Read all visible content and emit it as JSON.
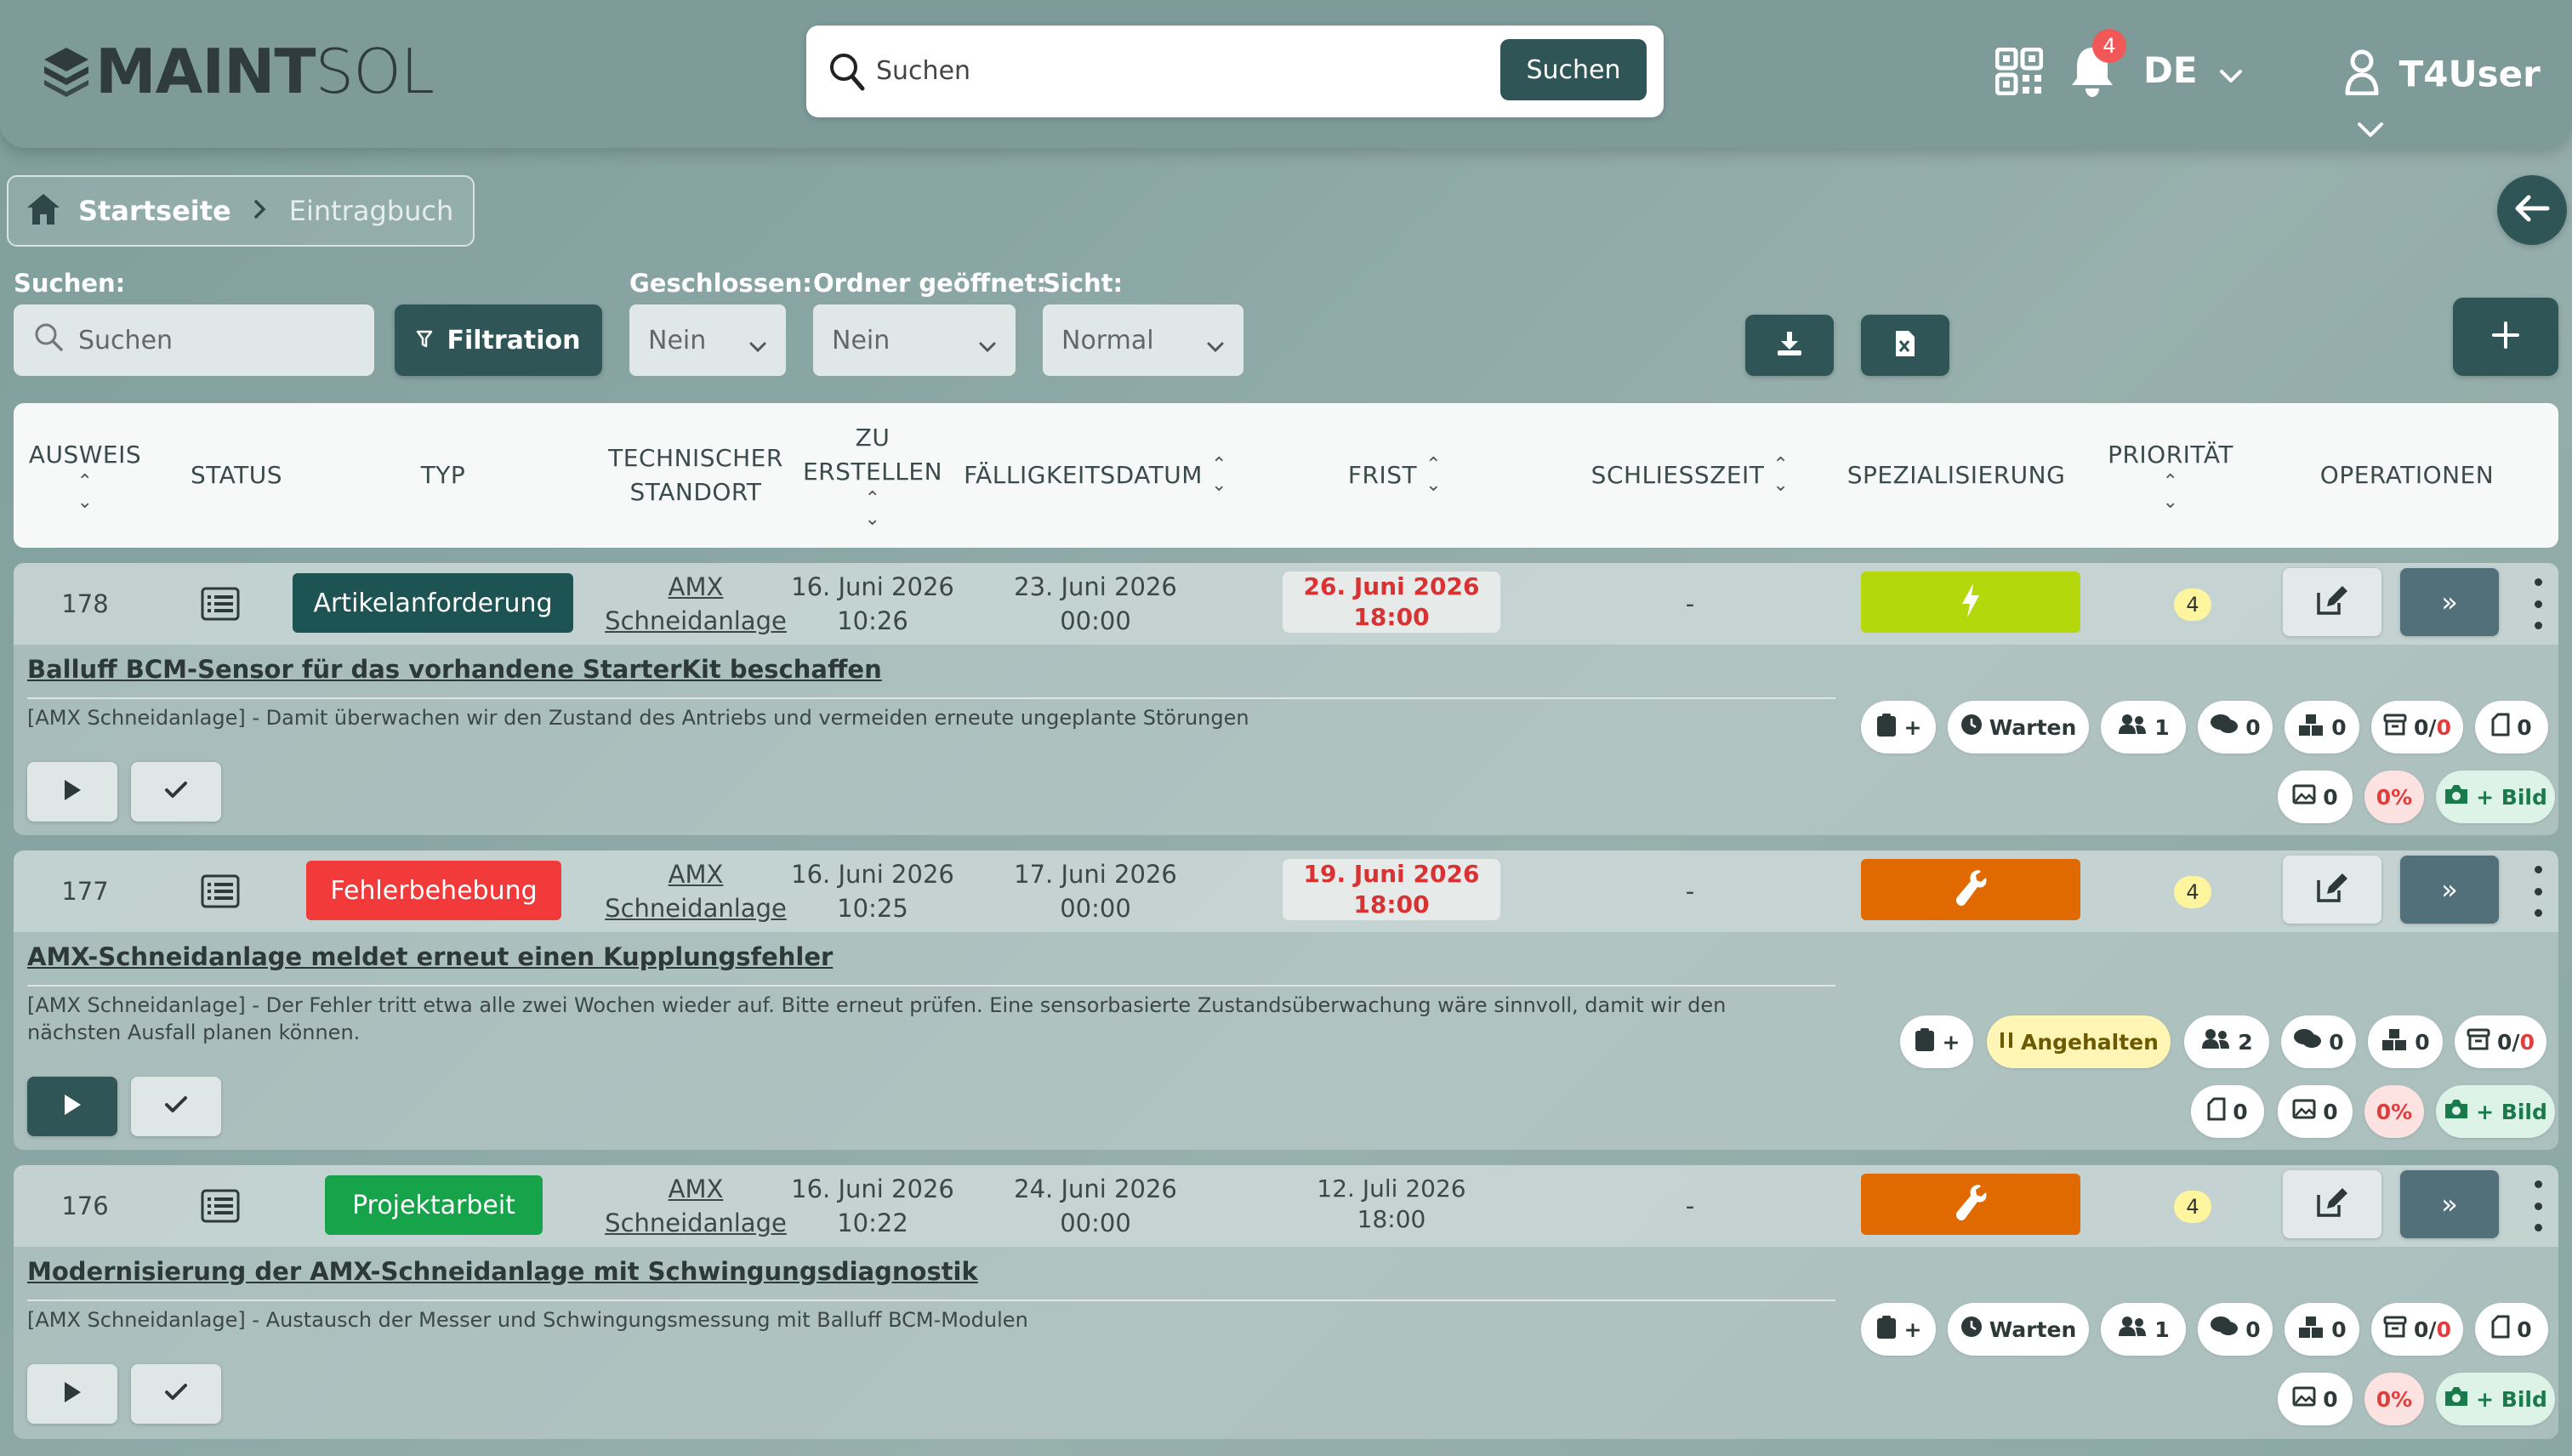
{
  "header": {
    "logo_strong": "MAINT",
    "logo_light": "SOL",
    "search_placeholder": "Suchen",
    "search_button": "Suchen",
    "notifications_count": "4",
    "language": "DE",
    "user": "T4User"
  },
  "breadcrumb": {
    "home": "Startseite",
    "current": "Eintragbuch"
  },
  "filters": {
    "search_label": "Suchen:",
    "search_placeholder": "Suchen",
    "filtration": "Filtration",
    "closed_label": "Geschlossen:",
    "closed_value": "Nein",
    "folder_label": "Ordner geöffnet:",
    "folder_value": "Nein",
    "view_label": "Sicht:",
    "view_value": "Normal"
  },
  "columns": {
    "id": "AUSWEIS",
    "status": "STATUS",
    "type": "TYP",
    "location_1": "TECHNISCHER",
    "location_2": "STANDORT",
    "create_1": "ZU",
    "create_2": "ERSTELLEN",
    "due": "FÄLLIGKEITSDATUM",
    "deadline": "FRIST",
    "close_time": "SCHLIESSZEIT",
    "specialization": "SPEZIALISIERUNG",
    "priority": "PRIORITÄT",
    "operations": "OPERATIONEN"
  },
  "rows": [
    {
      "id": "178",
      "type": "Artikelanforderung",
      "type_color": "#1e5354",
      "location_1": "AMX",
      "location_2": "Schneidanlage",
      "created_date": "16. Juni 2026",
      "created_time": "10:26",
      "due_date": "23. Juni 2026",
      "due_time": "00:00",
      "deadline_date": "26. Juni 2026",
      "deadline_time": "18:00",
      "close_time": "-",
      "spec_color": "#b5d80c",
      "spec_icon": "lightning-icon",
      "priority": "4",
      "title": "Balluff BCM-Sensor für das vorhandene StarterKit beschaffen",
      "description": "[AMX Schneidanlage] - Damit überwachen wir den Zustand des Antriebs und vermeiden erneute ungeplante Störungen",
      "state": "Warten",
      "users": "1",
      "comments": "0",
      "parts": "0",
      "archive_a": "0",
      "archive_b": "0",
      "docs": "0",
      "images": "0",
      "progress": "0%",
      "add_image": "+ Bild",
      "clip_plus": "+"
    },
    {
      "id": "177",
      "type": "Fehlerbehebung",
      "type_color": "#f23a3a",
      "location_1": "AMX",
      "location_2": "Schneidanlage",
      "created_date": "16. Juni 2026",
      "created_time": "10:25",
      "due_date": "17. Juni 2026",
      "due_time": "00:00",
      "deadline_date": "19. Juni 2026",
      "deadline_time": "18:00",
      "close_time": "-",
      "spec_color": "#e06a00",
      "spec_icon": "wrench-icon",
      "priority": "4",
      "title": "AMX-Schneidanlage meldet erneut einen Kupplungsfehler",
      "description_1": "[AMX Schneidanlage] - Der Fehler tritt etwa alle zwei Wochen wieder auf. Bitte erneut prüfen. Eine sensorbasierte Zustandsüberwachung wäre sinnvoll, damit wir den",
      "description_2": "nächsten Ausfall planen können.",
      "state": "Angehalten",
      "users": "2",
      "comments": "0",
      "parts": "0",
      "archive_a": "0",
      "archive_b": "0",
      "docs": "0",
      "images": "0",
      "progress": "0%",
      "add_image": "+ Bild",
      "clip_plus": "+"
    },
    {
      "id": "176",
      "type": "Projektarbeit",
      "type_color": "#17a34a",
      "location_1": "AMX",
      "location_2": "Schneidanlage",
      "created_date": "16. Juni 2026",
      "created_time": "10:22",
      "due_date": "24. Juni 2026",
      "due_time": "00:00",
      "deadline_date": "12. Juli 2026",
      "deadline_time": "18:00",
      "close_time": "-",
      "spec_color": "#e06a00",
      "spec_icon": "wrench-icon",
      "priority": "4",
      "title": "Modernisierung der AMX-Schneidanlage mit Schwingungsdiagnostik",
      "description": "[AMX Schneidanlage] - Austausch der Messer und Schwingungsmessung mit Balluff BCM-Modulen",
      "state": "Warten",
      "users": "1",
      "comments": "0",
      "parts": "0",
      "archive_a": "0",
      "archive_b": "0",
      "docs": "0",
      "images": "0",
      "progress": "0%",
      "add_image": "+ Bild",
      "clip_plus": "+"
    }
  ]
}
